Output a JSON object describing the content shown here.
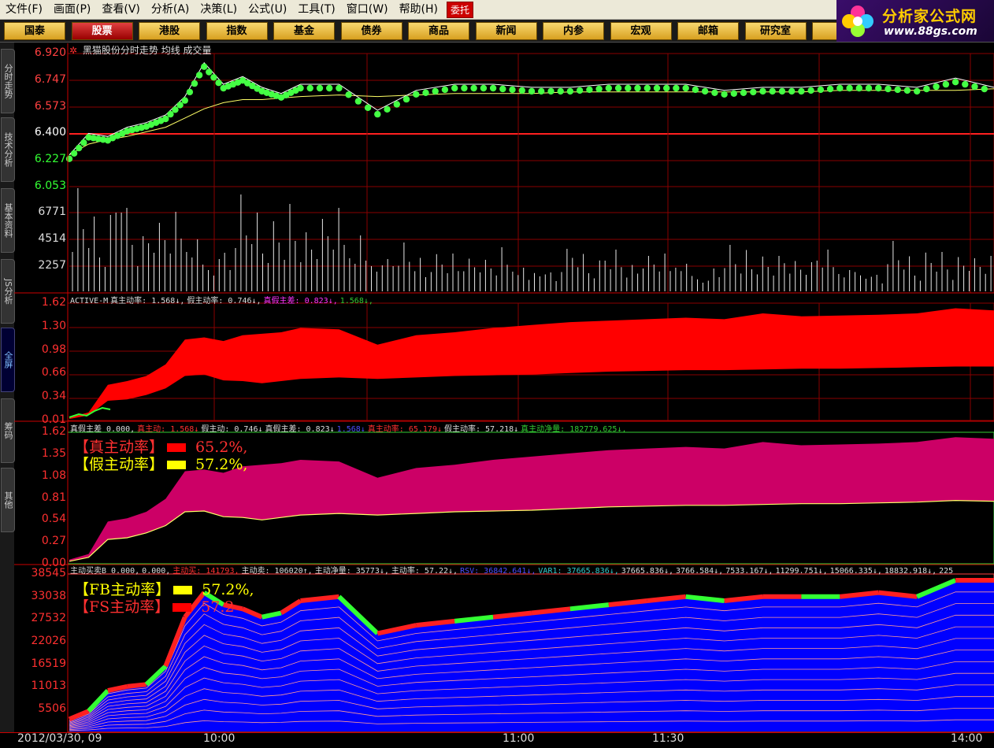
{
  "menu": [
    "文件(F)",
    "画面(P)",
    "查看(V)",
    "分析(A)",
    "决策(L)",
    "公式(U)",
    "工具(T)",
    "窗口(W)",
    "帮助(H)"
  ],
  "entrust": "委托",
  "tabs": [
    "国泰",
    "股票",
    "港股",
    "指数",
    "基金",
    "债券",
    "商品",
    "新闻",
    "内参",
    "宏观",
    "邮箱",
    "研究室",
    "设"
  ],
  "active_tab": 1,
  "logo": {
    "title": "分析家公式网",
    "url": "www.88gs.com"
  },
  "side_tabs": [
    "分时走势",
    "技术分析",
    "基本资料",
    "JS分析",
    "全屏",
    "筹码",
    "其他"
  ],
  "active_side_tab": 4,
  "price_panel": {
    "title": "黑猫股份分时走势 均线 成交量",
    "price_ticks": [
      "6.920",
      "6.747",
      "6.573",
      "6.400",
      "6.227",
      "6.053"
    ],
    "volume_ticks": [
      "6771",
      "4514",
      "2257"
    ]
  },
  "active_panel": {
    "header": [
      {
        "text": "ACTIVE-M",
        "color": "w"
      },
      {
        "text": "真主动率: 1.568↓,",
        "color": "w"
      },
      {
        "text": "假主动率: 0.746↓,",
        "color": "w"
      },
      {
        "text": "真假主差: 0.823↓,",
        "color": "m"
      },
      {
        "text": "1.568↓,",
        "color": "g"
      }
    ],
    "ticks": [
      "1.62",
      "1.30",
      "0.98",
      "0.66",
      "0.34",
      "0.01"
    ]
  },
  "diff_panel": {
    "header": [
      {
        "text": "真假主差 0.000,",
        "color": "w"
      },
      {
        "text": "真主动: 1.568↓",
        "color": "r"
      },
      {
        "text": "假主动: 0.746↓",
        "color": "w"
      },
      {
        "text": "真假主差: 0.823↓",
        "color": "w"
      },
      {
        "text": "1.568↓",
        "color": "b"
      },
      {
        "text": "真主动率: 65.179↓",
        "color": "r"
      },
      {
        "text": "假主动率: 57.218↓",
        "color": "w"
      },
      {
        "text": "真主动净量: 182779.625↓,",
        "color": "g"
      }
    ],
    "ticks": [
      "1.62",
      "1.35",
      "1.08",
      "0.81",
      "0.54",
      "0.27",
      "0.00"
    ],
    "legend": [
      {
        "label": "【真主动率】",
        "value": "65.2%,",
        "color": "#ff3030",
        "box": "#ff0000"
      },
      {
        "label": "【假主动率】",
        "value": "57.2%,",
        "color": "#ffff00",
        "box": "#ffff00"
      }
    ]
  },
  "fb_panel": {
    "header": [
      {
        "text": "主动买卖B 0.000,",
        "color": "w"
      },
      {
        "text": "0.000,",
        "color": "w"
      },
      {
        "text": "主动买: 141793,",
        "color": "r"
      },
      {
        "text": "主动卖: 106020↑,",
        "color": "w"
      },
      {
        "text": "主动净量: 35773↓,",
        "color": "w"
      },
      {
        "text": "主动率: 57.22↓,",
        "color": "w"
      },
      {
        "text": "RSV: 36842.641↓,",
        "color": "b"
      },
      {
        "text": "VAR1: 37665.836↓,",
        "color": "c"
      },
      {
        "text": "37665.836↓,",
        "color": "w"
      },
      {
        "text": "3766.584↓,",
        "color": "w"
      },
      {
        "text": "7533.167↓,",
        "color": "w"
      },
      {
        "text": "11299.751↓,",
        "color": "w"
      },
      {
        "text": "15066.335↓,",
        "color": "w"
      },
      {
        "text": "18832.918↓,",
        "color": "w"
      },
      {
        "text": "225",
        "color": "w"
      }
    ],
    "ticks": [
      "38545",
      "33038",
      "27532",
      "22026",
      "16519",
      "11013",
      "5506"
    ],
    "legend": [
      {
        "label": "【FB主动率】",
        "value": "57.2%,",
        "color": "#ffff00",
        "box": "#ffff00"
      },
      {
        "label": "【FS主动率】",
        "value": "57.2",
        "color": "#ff3030",
        "box": "#ff0000"
      }
    ]
  },
  "time_axis": [
    "2012/03/30, 09",
    "10:00",
    "11:00",
    "11:30",
    "14:00"
  ],
  "chart_data": [
    {
      "type": "line",
      "title": "黑猫股份分时走势 均线 成交量",
      "ylim": [
        6.053,
        6.92
      ],
      "x": [
        0,
        5,
        10,
        15,
        20,
        25,
        30,
        35,
        40,
        45,
        50,
        55,
        60,
        70,
        80,
        90,
        100,
        110,
        120,
        130,
        140,
        150,
        160,
        170,
        180,
        190,
        200,
        210,
        220,
        230,
        240
      ],
      "series": [
        {
          "name": "分时走势",
          "values": [
            6.26,
            6.4,
            6.38,
            6.44,
            6.47,
            6.52,
            6.64,
            6.86,
            6.72,
            6.77,
            6.7,
            6.66,
            6.72,
            6.72,
            6.55,
            6.68,
            6.72,
            6.72,
            6.7,
            6.7,
            6.72,
            6.72,
            6.72,
            6.68,
            6.7,
            6.7,
            6.72,
            6.72,
            6.7,
            6.76,
            6.7
          ]
        },
        {
          "name": "均线",
          "values": [
            6.26,
            6.33,
            6.36,
            6.38,
            6.41,
            6.44,
            6.5,
            6.56,
            6.6,
            6.62,
            6.62,
            6.63,
            6.64,
            6.65,
            6.64,
            6.65,
            6.66,
            6.66,
            6.66,
            6.67,
            6.67,
            6.67,
            6.67,
            6.67,
            6.67,
            6.67,
            6.68,
            6.68,
            6.68,
            6.68,
            6.69
          ]
        }
      ]
    },
    {
      "type": "area",
      "title": "ACTIVE-M",
      "ylim": [
        0.01,
        1.62
      ],
      "x": [
        0,
        5,
        10,
        15,
        20,
        25,
        30,
        35,
        40,
        45,
        50,
        55,
        60,
        70,
        80,
        90,
        100,
        110,
        120,
        130,
        140,
        150,
        160,
        170,
        180,
        190,
        200,
        210,
        220,
        230,
        240
      ],
      "series": [
        {
          "name": "真主动率",
          "values": [
            0.05,
            0.12,
            0.5,
            0.55,
            0.62,
            0.78,
            1.12,
            1.15,
            1.1,
            1.18,
            1.2,
            1.22,
            1.28,
            1.26,
            1.05,
            1.18,
            1.22,
            1.28,
            1.32,
            1.36,
            1.38,
            1.4,
            1.42,
            1.4,
            1.48,
            1.44,
            1.45,
            1.46,
            1.48,
            1.55,
            1.52
          ]
        },
        {
          "name": "假主动率",
          "values": [
            0.03,
            0.08,
            0.28,
            0.3,
            0.36,
            0.45,
            0.62,
            0.64,
            0.56,
            0.55,
            0.52,
            0.55,
            0.58,
            0.6,
            0.58,
            0.6,
            0.62,
            0.63,
            0.64,
            0.66,
            0.68,
            0.69,
            0.7,
            0.7,
            0.71,
            0.72,
            0.72,
            0.73,
            0.74,
            0.75,
            0.75
          ]
        }
      ]
    },
    {
      "type": "area",
      "title": "真假主差",
      "ylim": [
        0.0,
        1.62
      ],
      "x": [
        0,
        5,
        10,
        15,
        20,
        25,
        30,
        35,
        40,
        45,
        50,
        55,
        60,
        70,
        80,
        90,
        100,
        110,
        120,
        130,
        140,
        150,
        160,
        170,
        180,
        190,
        200,
        210,
        220,
        230,
        240
      ],
      "series": [
        {
          "name": "真主动率",
          "values": [
            0.05,
            0.12,
            0.52,
            0.56,
            0.64,
            0.8,
            1.14,
            1.16,
            1.12,
            1.2,
            1.22,
            1.24,
            1.28,
            1.26,
            1.06,
            1.18,
            1.22,
            1.28,
            1.32,
            1.36,
            1.4,
            1.42,
            1.44,
            1.42,
            1.5,
            1.46,
            1.47,
            1.48,
            1.5,
            1.56,
            1.54
          ]
        },
        {
          "name": "假主动率",
          "values": [
            0.03,
            0.08,
            0.3,
            0.32,
            0.38,
            0.47,
            0.64,
            0.65,
            0.58,
            0.57,
            0.54,
            0.57,
            0.6,
            0.62,
            0.6,
            0.62,
            0.64,
            0.65,
            0.66,
            0.68,
            0.7,
            0.71,
            0.72,
            0.72,
            0.73,
            0.74,
            0.74,
            0.75,
            0.76,
            0.78,
            0.77
          ]
        }
      ]
    },
    {
      "type": "area",
      "title": "主动买卖B",
      "ylim": [
        0,
        38545
      ],
      "x": [
        0,
        5,
        10,
        15,
        20,
        25,
        30,
        35,
        40,
        45,
        50,
        55,
        60,
        70,
        80,
        90,
        100,
        110,
        120,
        130,
        140,
        150,
        160,
        170,
        180,
        190,
        200,
        210,
        220,
        230,
        240
      ],
      "series": [
        {
          "name": "主动买",
          "values": [
            3000,
            5000,
            10000,
            11000,
            11500,
            16000,
            28000,
            34000,
            31000,
            30000,
            28000,
            29000,
            32000,
            33000,
            24000,
            26000,
            27000,
            28000,
            29000,
            30000,
            31000,
            32000,
            33000,
            32000,
            33000,
            33000,
            33000,
            34000,
            33000,
            37000,
            37000
          ]
        }
      ]
    }
  ]
}
